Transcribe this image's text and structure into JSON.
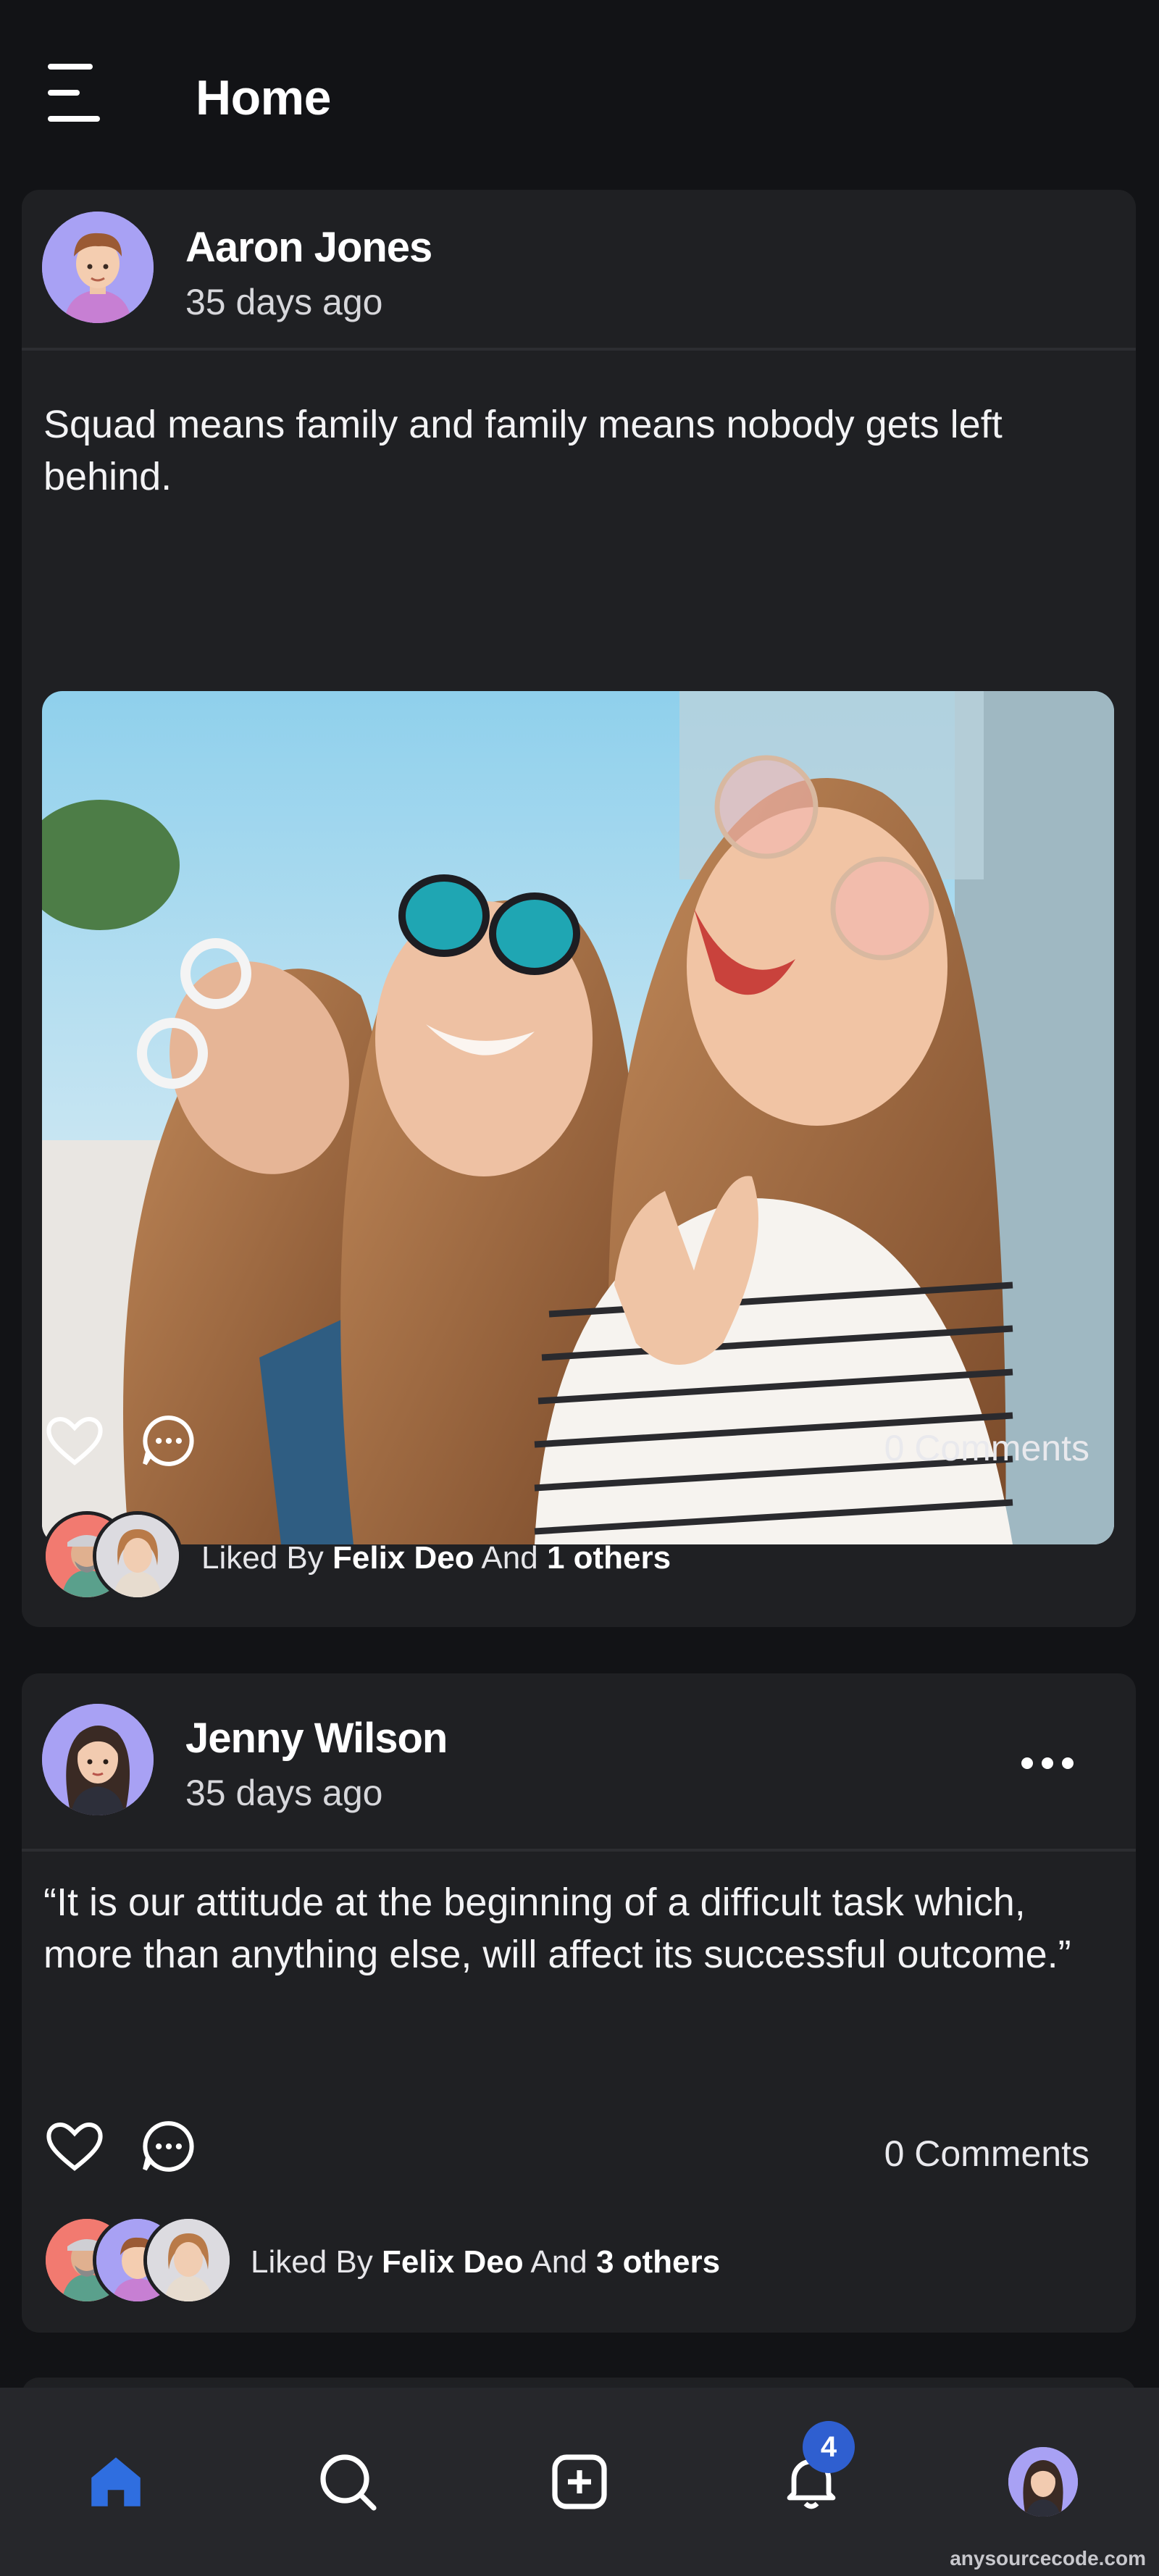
{
  "header": {
    "title": "Home"
  },
  "posts": [
    {
      "author": "Aaron Jones",
      "time": "35 days ago",
      "text": "Squad means family and family means nobody gets left behind.",
      "comments": "0 Comments",
      "liked_prefix": "Liked By",
      "liked_name": "Felix Deo",
      "liked_and": "And",
      "liked_others": "1 others"
    },
    {
      "author": "Jenny Wilson",
      "time": "35 days ago",
      "text": "“It is our attitude at the beginning of a difficult task which, more than anything else, will affect its successful outcome.”",
      "comments": "0 Comments",
      "liked_prefix": "Liked By",
      "liked_name": "Felix Deo",
      "liked_and": "And",
      "liked_others": "3 others"
    }
  ],
  "nav": {
    "items": [
      "home-icon",
      "search-icon",
      "add-post-icon",
      "notifications-icon",
      "profile-avatar"
    ],
    "notification_count": "4",
    "active": "home"
  },
  "watermark": "anysourcecode.com",
  "colors": {
    "background": "#121316",
    "card": "#1f2023",
    "accent": "#2f5fd0",
    "nav": "#26272b"
  }
}
